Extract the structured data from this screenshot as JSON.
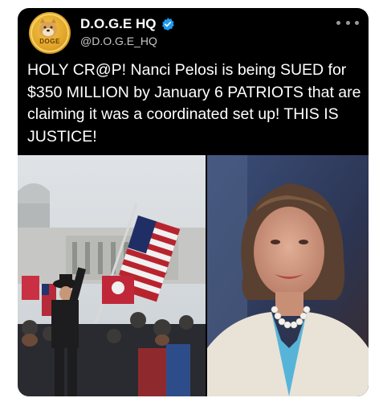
{
  "tweet": {
    "display_name": "D.O.G.E HQ",
    "handle": "@D.O.G.E_HQ",
    "avatar_text": "DOGE",
    "text": "HOLY CR@P! Nanci Pelosi is being SUED for $350 MILLION by January 6 PATRIOTS that are claiming it was a coordinated set up! THIS IS JUSTICE!"
  },
  "icons": {
    "verified": "verified-badge-icon",
    "more": "more-options-icon"
  },
  "colors": {
    "card_background": "#000000",
    "text": "#ffffff",
    "handle": "#c7c7c7",
    "verified_badge": "#1d9bf0",
    "avatar": "#e0a52a"
  }
}
